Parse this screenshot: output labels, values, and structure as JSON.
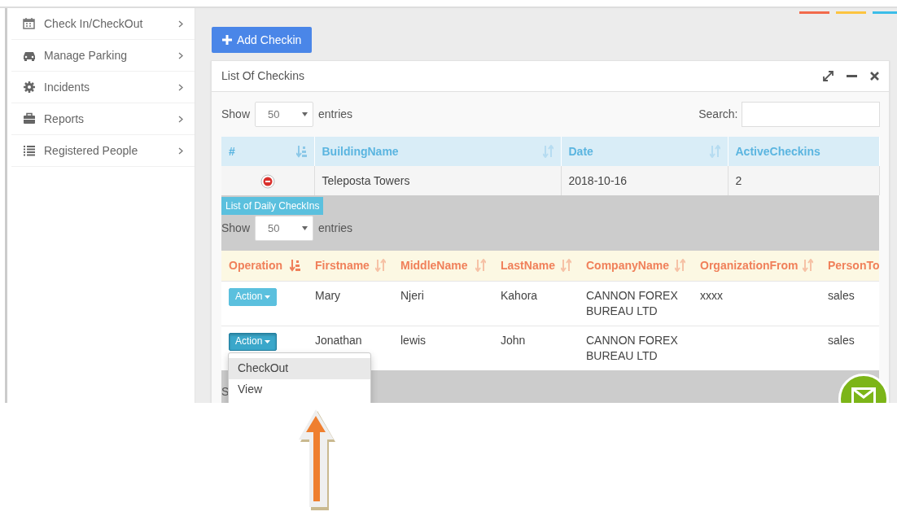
{
  "sidebar": {
    "items": [
      {
        "label": "Check In/CheckOut"
      },
      {
        "label": "Manage Parking"
      },
      {
        "label": "Incidents"
      },
      {
        "label": "Reports"
      },
      {
        "label": "Registered People"
      }
    ]
  },
  "add_button": {
    "label": "Add Checkin"
  },
  "panel": {
    "title": "List Of Checkins",
    "length_menu": {
      "prefix": "Show",
      "value": "50",
      "suffix": "entries"
    },
    "search": {
      "label": "Search:"
    },
    "table": {
      "columns": [
        {
          "label": "#",
          "sorted": true
        },
        {
          "label": "BuildingName",
          "sorted": false
        },
        {
          "label": "Date",
          "sorted": false
        },
        {
          "label": "ActiveCheckins"
        }
      ],
      "rows": [
        {
          "expanded": true,
          "cells": [
            "",
            "Teleposta Towers",
            "2018-10-16",
            "2"
          ]
        }
      ]
    },
    "detail": {
      "title": "List of Daily CheckIns",
      "length_menu": {
        "prefix": "Show",
        "value": "50",
        "suffix": "entries"
      },
      "table": {
        "columns": [
          {
            "label": "Operation",
            "sorted": true
          },
          {
            "label": "Firstname",
            "sorted": false
          },
          {
            "label": "MiddleName",
            "sorted": false
          },
          {
            "label": "LastName",
            "sorted": false
          },
          {
            "label": "CompanyName",
            "sorted": false
          },
          {
            "label": "OrganizationFrom",
            "sorted": false
          },
          {
            "label": "PersonTo"
          }
        ],
        "rows": [
          {
            "menu_open": false,
            "cells": [
              "Action",
              "Mary",
              "Njeri",
              "Kahora",
              "CANNON FOREX BUREAU LTD",
              "xxxx",
              "sales"
            ]
          },
          {
            "menu_open": true,
            "cells": [
              "Action",
              "Jonathan",
              "lewis",
              "John",
              "CANNON FOREX BUREAU LTD",
              null,
              "sales"
            ]
          }
        ]
      },
      "footer_text": "S"
    }
  },
  "dropdown": {
    "items": [
      {
        "label": "CheckOut",
        "selected": true
      },
      {
        "label": "View",
        "selected": false
      }
    ]
  }
}
